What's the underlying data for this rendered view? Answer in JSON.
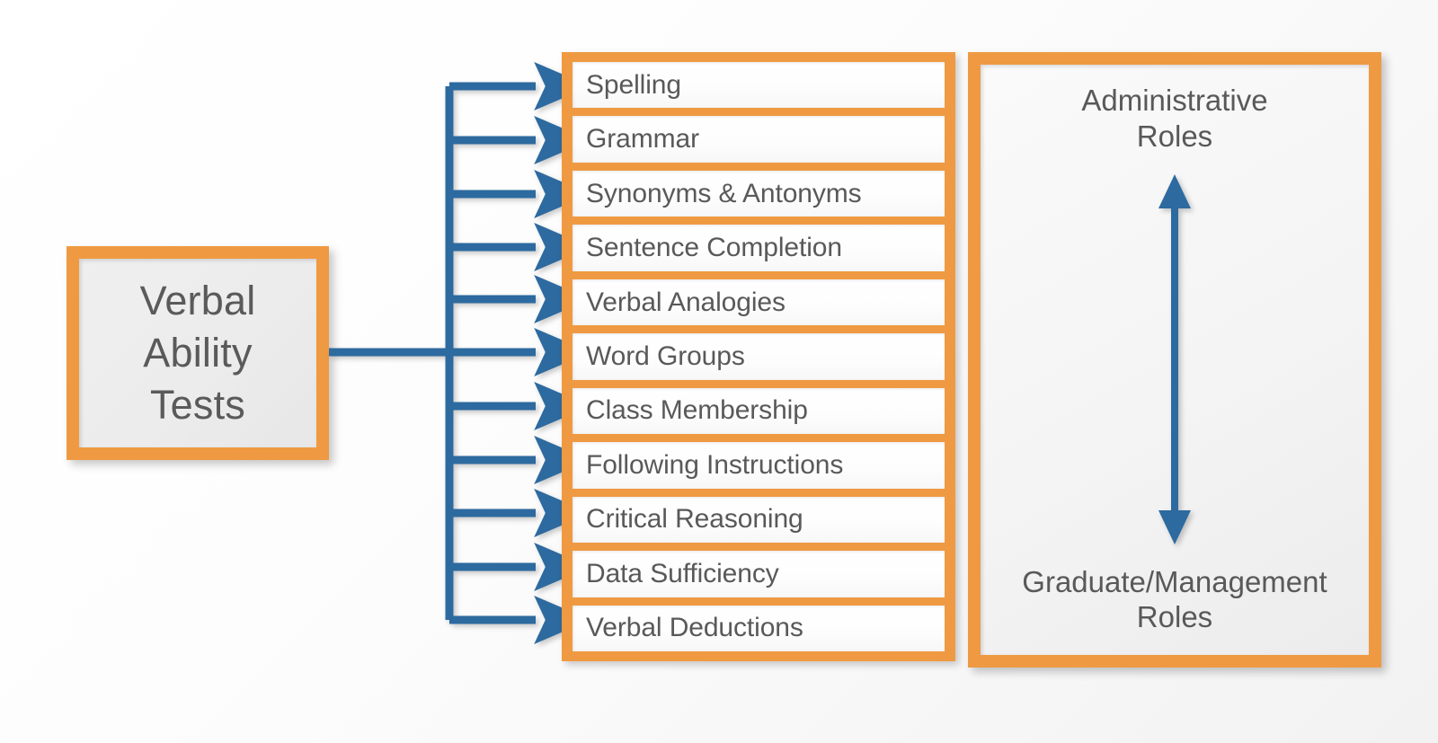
{
  "diagram": {
    "title": "Verbal Ability Tests",
    "source": {
      "label": "Verbal\nAbility\nTests"
    },
    "tests": [
      {
        "label": "Spelling"
      },
      {
        "label": "Grammar"
      },
      {
        "label": "Synonyms & Antonyms"
      },
      {
        "label": "Sentence Completion"
      },
      {
        "label": "Verbal Analogies"
      },
      {
        "label": "Word Groups"
      },
      {
        "label": "Class Membership"
      },
      {
        "label": "Following Instructions"
      },
      {
        "label": "Critical Reasoning"
      },
      {
        "label": "Data Sufficiency"
      },
      {
        "label": "Verbal Deductions"
      }
    ],
    "roles": {
      "top_label": "Administrative\nRoles",
      "bottom_label": "Graduate/Management\nRoles",
      "arrow": "double-headed-vertical-arrow"
    },
    "colors": {
      "accent_orange": "#ef9a42",
      "arrow_blue": "#2d6a9f",
      "text_gray": "#595959",
      "box_fill": "#efefef",
      "item_fill": "#ffffff",
      "background": "#fafafa"
    }
  }
}
